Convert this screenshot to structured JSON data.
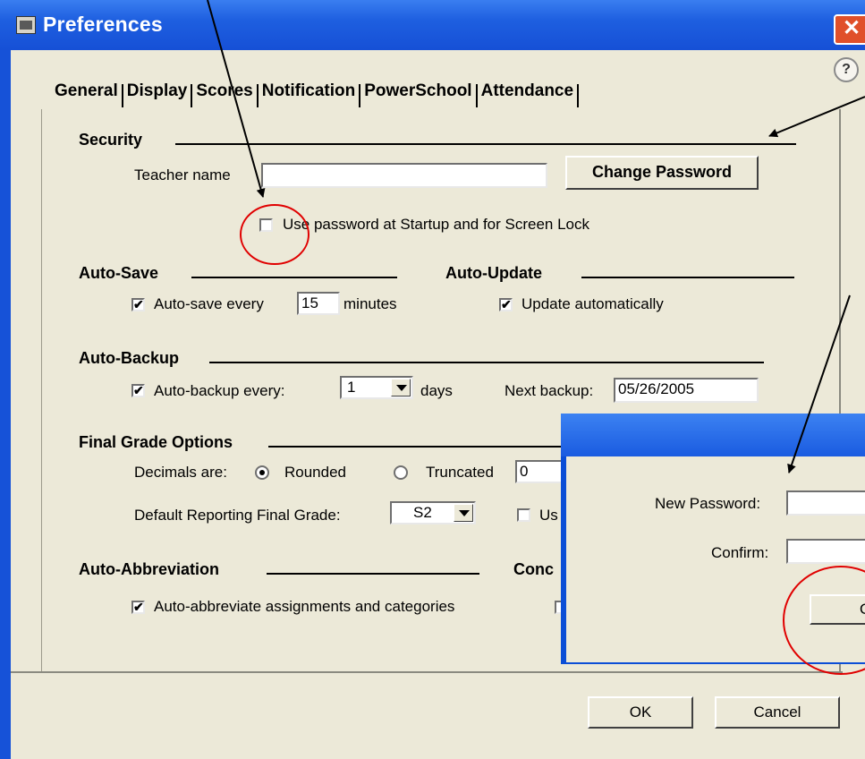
{
  "window": {
    "title": "Preferences",
    "close_glyph": "✕",
    "help_glyph": "?"
  },
  "tabs": [
    "General",
    "Display",
    "Scores",
    "Notification",
    "PowerSchool",
    "Attendance"
  ],
  "security": {
    "heading": "Security",
    "teacher_name_label": "Teacher name",
    "teacher_name_value": "",
    "change_password_label": "Change Password",
    "use_password_label": "Use password at Startup and for Screen Lock",
    "use_password_checked": false
  },
  "auto_save": {
    "heading": "Auto-Save",
    "prefix": "Auto-save every",
    "minutes_value": "15",
    "suffix": "minutes",
    "checked": true
  },
  "auto_update": {
    "heading": "Auto-Update",
    "label": "Update automatically",
    "checked": true
  },
  "auto_backup": {
    "heading": "Auto-Backup",
    "prefix": "Auto-backup every:",
    "days_value": "1",
    "suffix": "days",
    "next_backup_label": "Next backup:",
    "next_backup_value": "05/26/2005",
    "checked": true
  },
  "final_grade": {
    "heading": "Final Grade Options",
    "decimals_label": "Decimals are:",
    "rounded_label": "Rounded",
    "truncated_label": "Truncated",
    "truncated_value": "0",
    "selected": "Rounded",
    "default_reporting_label": "Default Reporting Final Grade:",
    "default_reporting_value": "S2",
    "partial_checkbox_label": "Us"
  },
  "auto_abbreviation": {
    "heading": "Auto-Abbreviation",
    "label": "Auto-abbreviate assignments and categories",
    "checked": true,
    "concurrent_heading_partial": "Conc"
  },
  "footer": {
    "ok_label": "OK",
    "cancel_label": "Cancel"
  },
  "password_dialog": {
    "new_password_label": "New Password:",
    "confirm_label": "Confirm:",
    "button_partial_label": "O"
  },
  "icons": {
    "check": "✔",
    "app_icon": "gradebook-app-icon"
  },
  "colors": {
    "titlebar_blue": "#1e5fe0",
    "dialog_face": "#ece9d8",
    "close_red": "#e0502a",
    "annotation_red": "#e00000"
  }
}
